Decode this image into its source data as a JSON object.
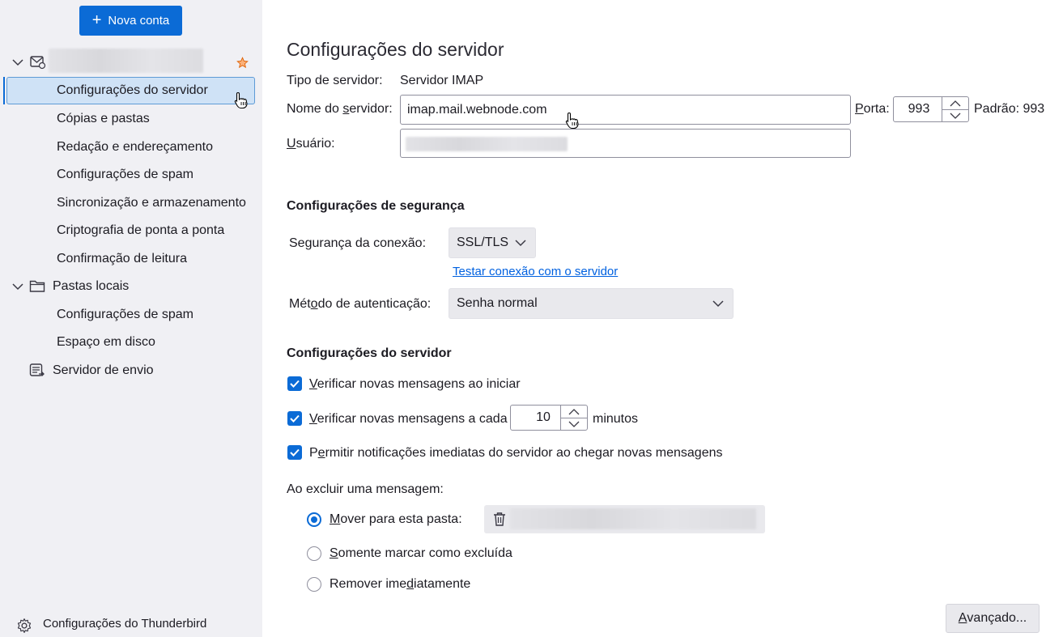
{
  "sidebar": {
    "new_account_label": "Nova conta",
    "account_items": [
      {
        "label": "Configurações do servidor"
      },
      {
        "label": "Cópias e pastas"
      },
      {
        "label": "Redação e endereçamento"
      },
      {
        "label": "Configurações de spam"
      },
      {
        "label": "Sincronização e armazenamento"
      },
      {
        "label": "Criptografia de ponta a ponta"
      },
      {
        "label": "Confirmação de leitura"
      }
    ],
    "local_folders_label": "Pastas locais",
    "local_items": [
      {
        "label": "Configurações de spam"
      },
      {
        "label": "Espaço em disco"
      }
    ],
    "outgoing_server_label": "Servidor de envio",
    "footer_label": "Configurações do Thunderbird"
  },
  "server": {
    "title": "Configurações do servidor",
    "server_type_label": "Tipo de servidor:",
    "server_type_value": "Servidor IMAP",
    "server_name_label_pre": "Nome do ",
    "server_name_label_u": "s",
    "server_name_label_post": "ervidor:",
    "server_name_value": "imap.mail.webnode.com",
    "port_label_u": "P",
    "port_label_post": "orta:",
    "port_value": "993",
    "default_label": "Padrão: 993",
    "user_label_u": "U",
    "user_label_post": "suário:"
  },
  "security": {
    "heading": "Configurações de segurança",
    "connection_label": "Segurança da conexão:",
    "connection_value": "SSL/TLS",
    "test_link": "Testar conexão com o servidor",
    "auth_label_pre": "Mét",
    "auth_label_u": "o",
    "auth_label_post": "do de autenticação:",
    "auth_value": "Senha normal"
  },
  "settings": {
    "heading": "Configurações do servidor",
    "check_startup_u": "V",
    "check_startup_post": "erificar novas mensagens ao iniciar",
    "check_every_u": "V",
    "check_every_post": "erificar novas mensagens a cada",
    "minutes_value": "10",
    "minutes_label": "minutos",
    "push_pre": "P",
    "push_u": "e",
    "push_post": "rmitir notificações imediatas do servidor ao chegar novas mensagens",
    "delete_label": "Ao excluir uma mensagem:",
    "move_u": "M",
    "move_post": "over para esta pasta:",
    "mark_u": "S",
    "mark_post": "omente marcar como excluída",
    "remove_pre": "Remover ime",
    "remove_u": "d",
    "remove_post": "iatamente",
    "advanced_u": "A",
    "advanced_post": "vançado..."
  }
}
